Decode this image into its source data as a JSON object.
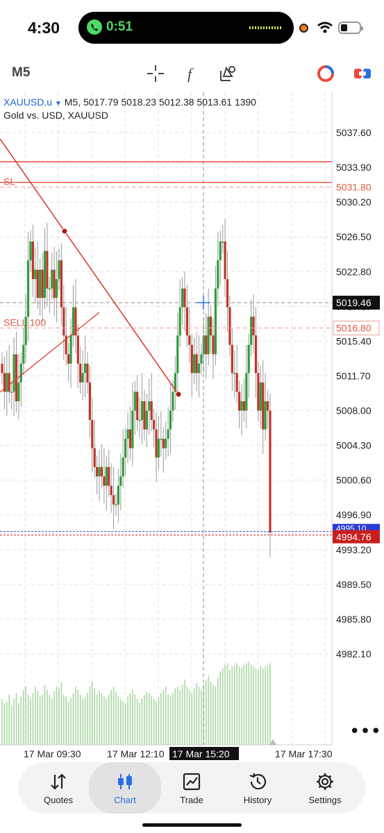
{
  "status_bar": {
    "time": "4:30",
    "call_timer": "0:51"
  },
  "toolbar": {
    "timeframe": "M5"
  },
  "chart_info": {
    "symbol": "XAUUSD.u",
    "timeframe": "M5",
    "ohlc": "5017.79 5018.23 5012.38 5013.61 1390",
    "description": "Gold vs. USD, XAUUSD"
  },
  "chart_data": {
    "type": "candlestick",
    "symbol": "XAUUSD.u",
    "ylim": [
      4978,
      5041
    ],
    "y_ticks": [
      "5037.60",
      "5033.90",
      "5030.20",
      "5026.50",
      "5022.80",
      "5019.10",
      "5015.40",
      "5011.70",
      "5008.00",
      "5004.30",
      "5000.60",
      "4996.90",
      "4993.20",
      "4989.50",
      "4985.80",
      "4982.10"
    ],
    "x_ticks": [
      "17 Mar 09:30",
      "17 Mar 12:10",
      "17 Mar 15:20",
      "17 Mar 17:30"
    ],
    "crosshair": {
      "time": "17 Mar 15:20",
      "price": "5019.46"
    },
    "price_labels": {
      "sl": "5031.80",
      "sell": "5016.80",
      "current": "4994.76",
      "hidden": "4995.10"
    },
    "line_labels": {
      "sl": "SL",
      "sell": "SELL 100"
    },
    "horizontal_lines": {
      "red_line_1": 5034.5,
      "red_line_2": 5032.3
    },
    "closes": [
      5012,
      5010,
      5012,
      5010,
      5010,
      5014,
      5009,
      5011,
      5013,
      5015,
      5018,
      5024,
      5026,
      5022,
      5023,
      5020,
      5023,
      5020,
      5025,
      5021,
      5021,
      5023,
      5020,
      5022,
      5024,
      5019,
      5016,
      5014,
      5013,
      5016,
      5019,
      5016,
      5013,
      5011,
      5012,
      5013,
      5011,
      5007,
      5004,
      5002,
      5001,
      5002,
      5001,
      5000,
      5002,
      5000,
      4999,
      4998,
      4998,
      5000,
      5001,
      5003,
      5005,
      5006,
      5004,
      5008,
      5010,
      5007,
      5007,
      5009,
      5006,
      5008,
      5009,
      5007,
      5006,
      5003,
      5005,
      5005,
      5004,
      5005,
      5006,
      5008,
      5010,
      5012,
      5016,
      5019,
      5021,
      5019,
      5016,
      5015,
      5012,
      5014,
      5012,
      5013,
      5014,
      5016,
      5014,
      5018,
      5016,
      5014,
      5021,
      5024,
      5026,
      5026,
      5022,
      5019,
      5015,
      5012,
      5012,
      5010,
      5008,
      5009,
      5008,
      5012,
      5015,
      5018,
      5016,
      5012,
      5008,
      5011,
      5006,
      5009,
      5008,
      4995
    ],
    "volumes": [
      55,
      50,
      52,
      60,
      48,
      55,
      62,
      50,
      58,
      66,
      70,
      60,
      55,
      62,
      70,
      65,
      58,
      60,
      72,
      66,
      60,
      55,
      64,
      70,
      68,
      75,
      60,
      58,
      52,
      56,
      62,
      70,
      66,
      60,
      55,
      58,
      62,
      70,
      75,
      68,
      60,
      65,
      62,
      58,
      55,
      60,
      66,
      70,
      64,
      58,
      55,
      52,
      50,
      58,
      62,
      66,
      60,
      55,
      50,
      56,
      60,
      64,
      62,
      58,
      55,
      52,
      58,
      62,
      66,
      70,
      60,
      58,
      62,
      68,
      70,
      66,
      72,
      78,
      70,
      66,
      62,
      68,
      74,
      70,
      66,
      72,
      78,
      82,
      76,
      72,
      70,
      80,
      88,
      92,
      96,
      98,
      90,
      94,
      96,
      98,
      94,
      92,
      96,
      98,
      100,
      96,
      94,
      92,
      90,
      95,
      92,
      94,
      96,
      98
    ]
  },
  "tabs": [
    {
      "label": "Quotes",
      "icon": "quotes-icon"
    },
    {
      "label": "Chart",
      "icon": "chart-icon"
    },
    {
      "label": "Trade",
      "icon": "trade-icon"
    },
    {
      "label": "History",
      "icon": "history-icon"
    },
    {
      "label": "Settings",
      "icon": "settings-icon"
    }
  ],
  "colors": {
    "bull": "#2e9e3a",
    "bear": "#c0332b",
    "accent": "#2a6ee6",
    "line": "#e23b2e"
  }
}
